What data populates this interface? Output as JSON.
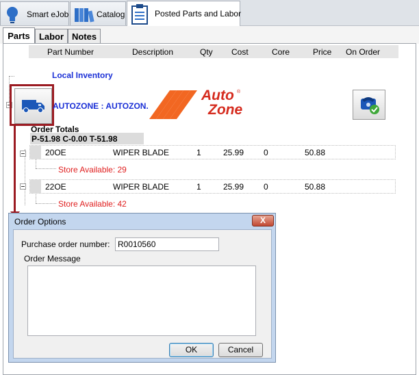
{
  "top_tabs": [
    {
      "label": "Smart eJob",
      "icon": "lightbulb-icon"
    },
    {
      "label": "Catalog",
      "icon": "catalog-books-icon"
    },
    {
      "label": "Posted Parts and Labor",
      "icon": "clipboard-list-icon"
    }
  ],
  "sub_tabs": [
    "Parts",
    "Labor",
    "Notes"
  ],
  "columns": {
    "part_number": "Part Number",
    "description": "Description",
    "qty": "Qty",
    "cost": "Cost",
    "core": "Core",
    "price": "Price",
    "on_order": "On Order"
  },
  "local_inventory": "Local Inventory",
  "vendor": {
    "name": "AUTOZONE : AUTOZON...",
    "logo_line1": "Auto",
    "logo_line2": "Zone",
    "logo_trademark": "®"
  },
  "order_totals": {
    "label": "Order Totals",
    "summary": "P-51.98 C-0.00 T-51.98"
  },
  "parts": [
    {
      "part_number": "20OE",
      "description": "WIPER BLADE",
      "qty": "1",
      "cost": "25.99",
      "core": "0",
      "price": "50.88",
      "store": "Store Available: 29"
    },
    {
      "part_number": "22OE",
      "description": "WIPER BLADE",
      "qty": "1",
      "cost": "25.99",
      "core": "0",
      "price": "50.88",
      "store": "Store Available: 42"
    }
  ],
  "dialog": {
    "title": "Order Options",
    "close": "X",
    "po_label": "Purchase order number:",
    "po_value": "R0010560",
    "message_label": "Order Message",
    "ok": "OK",
    "cancel": "Cancel"
  },
  "colors": {
    "highlight": "#9b1b22",
    "link_blue": "#1a2fd6",
    "store_red": "#e02020",
    "autozone_orange": "#f26722",
    "autozone_red": "#d52b1e"
  }
}
